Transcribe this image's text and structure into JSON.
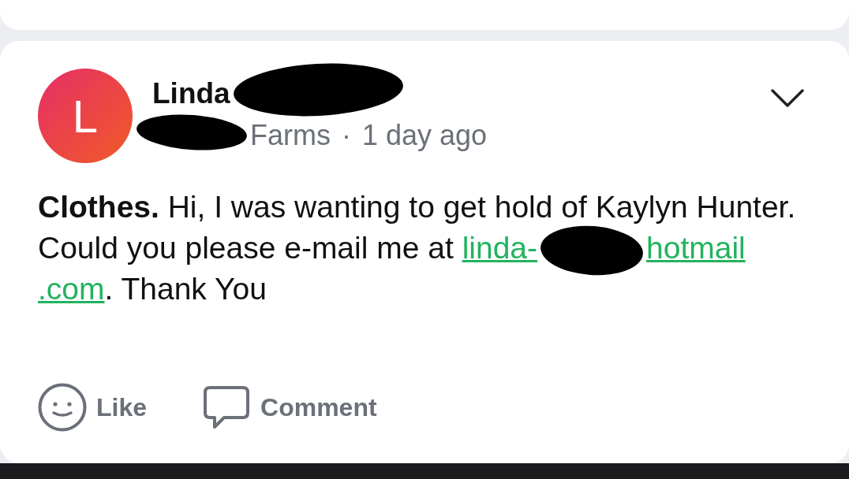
{
  "author": {
    "avatar_letter": "L",
    "name": "Linda",
    "group": "Farms",
    "separator": "·",
    "time": "1 day ago"
  },
  "post": {
    "text": "**Clothes.** Hi, I was wanting to get hold of Kaylyn Hunter. Could you please e-mail me at",
    "email_link": [
      "linda-",
      "hotmail",
      ".com"
    ],
    "text_after": ". Thank You"
  },
  "actions": [
    {
      "label": "Like",
      "kind": "like"
    },
    {
      "label": "Comment",
      "kind": "comment"
    }
  ]
}
